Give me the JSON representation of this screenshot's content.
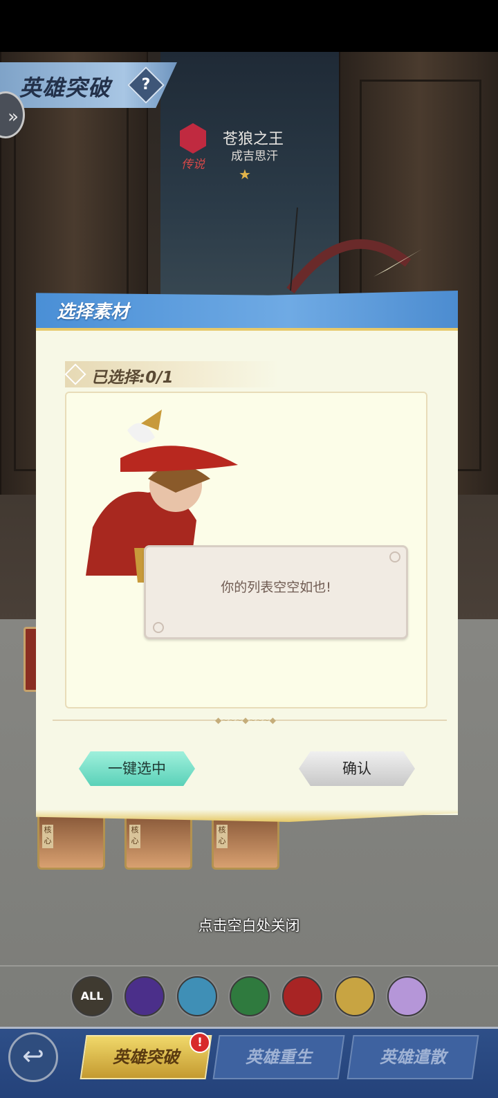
{
  "header": {
    "page_title": "英雄突破",
    "help_icon": "question-icon",
    "side_icon": "double-chevron-right-icon"
  },
  "hero": {
    "rarity": "传说",
    "title": "苍狼之王",
    "name": "成吉思汗",
    "stars": "★"
  },
  "modal": {
    "title": "选择素材",
    "selected_label": "已选择:0/1",
    "empty_message": "你的列表空空如也!",
    "select_all_button": "一键选中",
    "confirm_button": "确认"
  },
  "material_cards": [
    {
      "core": "核心"
    },
    {
      "core": "核心"
    },
    {
      "core": "核心"
    }
  ],
  "close_hint": "点击空白处关闭",
  "filters": [
    {
      "label": "ALL",
      "icon": "all-filter-icon",
      "color": "#3f3a30"
    },
    {
      "label": "",
      "icon": "purple-faction-icon",
      "color": "#4b2f8a"
    },
    {
      "label": "",
      "icon": "ice-faction-icon",
      "color": "#3f8fb6"
    },
    {
      "label": "",
      "icon": "green-faction-icon",
      "color": "#2f7a3e"
    },
    {
      "label": "",
      "icon": "red-faction-icon",
      "color": "#a82424"
    },
    {
      "label": "",
      "icon": "gold-faction-icon",
      "color": "#c8a442"
    },
    {
      "label": "",
      "icon": "violet-faction-icon",
      "color": "#b596d8"
    }
  ],
  "bottom_nav": {
    "back_icon": "back-arrow-icon",
    "tabs": [
      {
        "label": "英雄突破",
        "active": true
      },
      {
        "label": "英雄重生",
        "active": false
      },
      {
        "label": "英雄遣散",
        "active": false
      }
    ],
    "badge": "!"
  },
  "colors": {
    "modal_header": "#4a8fd6",
    "modal_body": "#f7f8e6",
    "select_all": "#5ad1b8",
    "active_tab": "#e6c866"
  }
}
